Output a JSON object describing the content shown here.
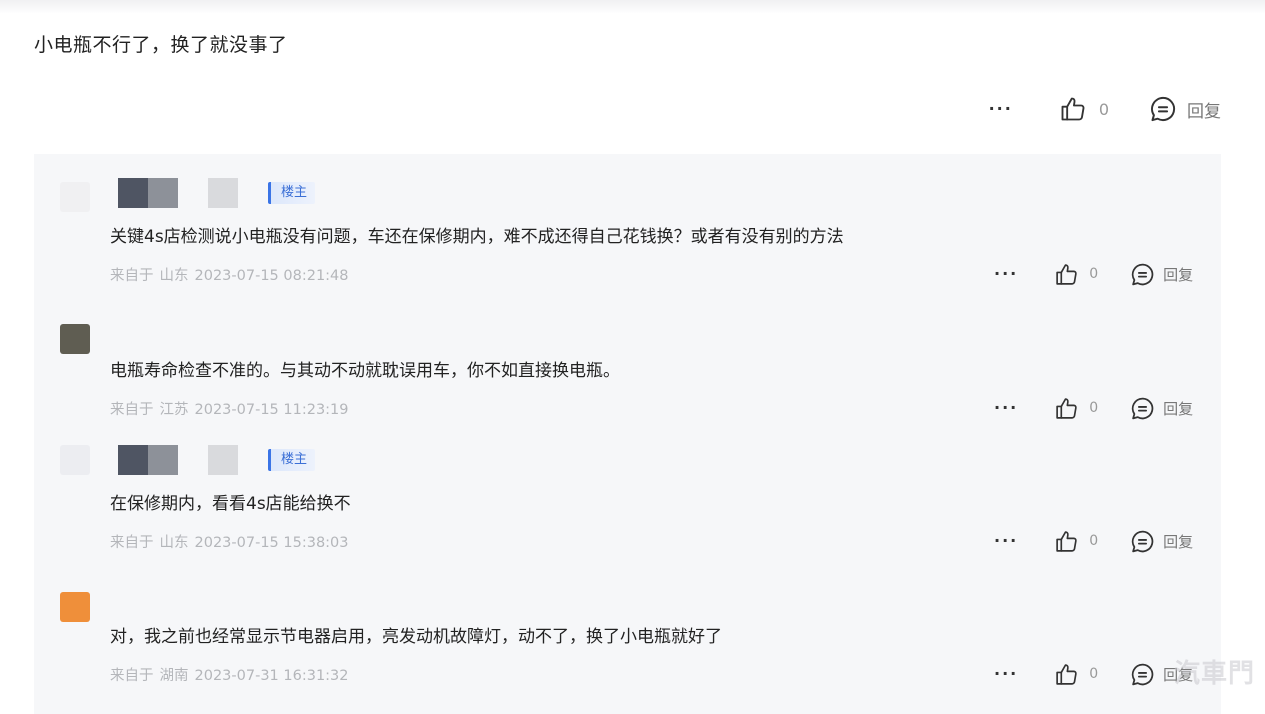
{
  "main_comment": {
    "text": "小电瓶不行了，换了就没事了",
    "more": "···",
    "likes": "0",
    "reply_label": "回复"
  },
  "replies": [
    {
      "is_op": true,
      "badge": "楼主",
      "avatar_color": "#f0f0f2",
      "text": "关键4s店检测说小电瓶没有问题，车还在保修期内，难不成还得自己花钱换？或者有没有别的方法",
      "meta_prefix": "来自于",
      "region": "山东",
      "time": "2023-07-15 08:21:48",
      "more": "···",
      "likes": "0",
      "reply_label": "回复"
    },
    {
      "is_op": false,
      "badge": "",
      "avatar_color": "#5f5d52",
      "text": "电瓶寿命检查不准的。与其动不动就耽误用车，你不如直接换电瓶。",
      "meta_prefix": "来自于",
      "region": "江苏",
      "time": "2023-07-15 11:23:19",
      "more": "···",
      "likes": "0",
      "reply_label": "回复"
    },
    {
      "is_op": true,
      "badge": "楼主",
      "avatar_color": "#ecedf1",
      "text": "在保修期内，看看4s店能给换不",
      "meta_prefix": "来自于",
      "region": "山东",
      "time": "2023-07-15 15:38:03",
      "more": "···",
      "likes": "0",
      "reply_label": "回复"
    },
    {
      "is_op": false,
      "badge": "",
      "avatar_color": "#ef8f3a",
      "text": "对，我之前也经常显示节电器启用，亮发动机故障灯，动不了，换了小电瓶就好了",
      "meta_prefix": "来自于",
      "region": "湖南",
      "time": "2023-07-31 16:31:32",
      "more": "···",
      "likes": "0",
      "reply_label": "回复"
    }
  ],
  "watermark": "汽車門",
  "colors": {
    "op_badge": "#3a74e6",
    "reply_box_bg": "#f6f7f9"
  }
}
